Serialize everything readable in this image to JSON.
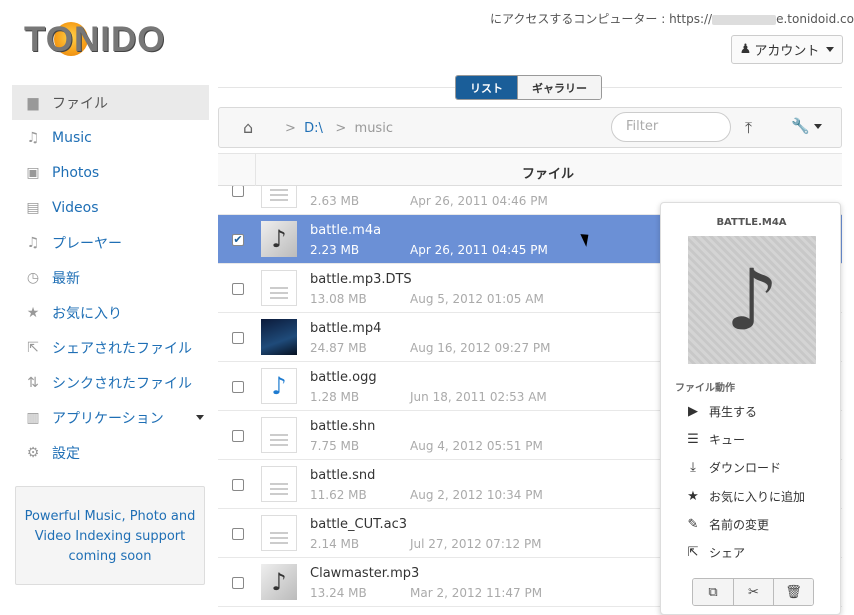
{
  "logo": {
    "text": "TONIDO"
  },
  "header": {
    "access_prefix": "にアクセスするコンピューター : https://",
    "access_suffix": "e.tonidoid.com",
    "account_label": "アカウント"
  },
  "sidebar": {
    "items": [
      {
        "label": "ファイル",
        "icon": "folder-icon",
        "glyph": "▆"
      },
      {
        "label": "Music",
        "icon": "music-icon",
        "glyph": "♫"
      },
      {
        "label": "Photos",
        "icon": "photo-icon",
        "glyph": "▣"
      },
      {
        "label": "Videos",
        "icon": "film-icon",
        "glyph": "▤"
      },
      {
        "label": "プレーヤー",
        "icon": "music-note-icon",
        "glyph": "♫"
      },
      {
        "label": "最新",
        "icon": "clock-icon",
        "glyph": "◷"
      },
      {
        "label": "お気に入り",
        "icon": "star-icon",
        "glyph": "★"
      },
      {
        "label": "シェアされたファイル",
        "icon": "share-icon",
        "glyph": "⇱"
      },
      {
        "label": "シンクされたファイル",
        "icon": "sync-icon",
        "glyph": "⇅"
      },
      {
        "label": "アプリケーション",
        "icon": "chart-icon",
        "glyph": "▥"
      },
      {
        "label": "設定",
        "icon": "gears-icon",
        "glyph": "⚙"
      }
    ],
    "promo": "Powerful Music, Photo and Video Indexing support coming soon"
  },
  "view": {
    "list": "リスト",
    "gallery": "ギャラリー"
  },
  "toolbar": {
    "drive": "D:\\",
    "folder": "music",
    "filter_placeholder": "Filter"
  },
  "table": {
    "column_header": "ファイル"
  },
  "files": [
    {
      "name": "",
      "size": "2.63 MB",
      "date": "Apr 26, 2011 04:46 PM",
      "thumb": "doc",
      "checked": false,
      "selected": false
    },
    {
      "name": "battle.m4a",
      "size": "2.23 MB",
      "date": "Apr 26, 2011 04:45 PM",
      "thumb": "music",
      "checked": true,
      "selected": true
    },
    {
      "name": "battle.mp3.DTS",
      "size": "13.08 MB",
      "date": "Aug 5, 2012 01:05 AM",
      "thumb": "doc",
      "checked": false,
      "selected": false
    },
    {
      "name": "battle.mp4",
      "size": "24.87 MB",
      "date": "Aug 16, 2012 09:27 PM",
      "thumb": "video",
      "checked": false,
      "selected": false
    },
    {
      "name": "battle.ogg",
      "size": "1.28 MB",
      "date": "Jun 18, 2011 02:53 AM",
      "thumb": "music-blue",
      "checked": false,
      "selected": false
    },
    {
      "name": "battle.shn",
      "size": "7.75 MB",
      "date": "Aug 4, 2012 05:51 PM",
      "thumb": "doc",
      "checked": false,
      "selected": false
    },
    {
      "name": "battle.snd",
      "size": "11.62 MB",
      "date": "Aug 2, 2012 10:34 PM",
      "thumb": "doc",
      "checked": false,
      "selected": false
    },
    {
      "name": "battle_CUT.ac3",
      "size": "2.14 MB",
      "date": "Jul 27, 2012 07:12 PM",
      "thumb": "doc",
      "checked": false,
      "selected": false
    },
    {
      "name": "Clawmaster.mp3",
      "size": "13.24 MB",
      "date": "Mar 2, 2012 11:47 PM",
      "thumb": "music",
      "checked": false,
      "selected": false
    }
  ],
  "panel": {
    "title": "BATTLE.M4A",
    "actions_header": "ファイル動作",
    "actions": [
      {
        "label": "再生する",
        "icon": "play-icon",
        "glyph": "▶"
      },
      {
        "label": "キュー",
        "icon": "list-icon",
        "glyph": "☰"
      },
      {
        "label": "ダウンロード",
        "icon": "download-icon",
        "glyph": "⤓"
      },
      {
        "label": "お気に入りに追加",
        "icon": "star-icon",
        "glyph": "★"
      },
      {
        "label": "名前の変更",
        "icon": "edit-icon",
        "glyph": "✎"
      },
      {
        "label": "シェア",
        "icon": "share-icon",
        "glyph": "⇱"
      }
    ]
  },
  "colors": {
    "brand_blue": "#1a5e99",
    "link_blue": "#1f6fb5",
    "selected_row": "#6b90d6"
  }
}
